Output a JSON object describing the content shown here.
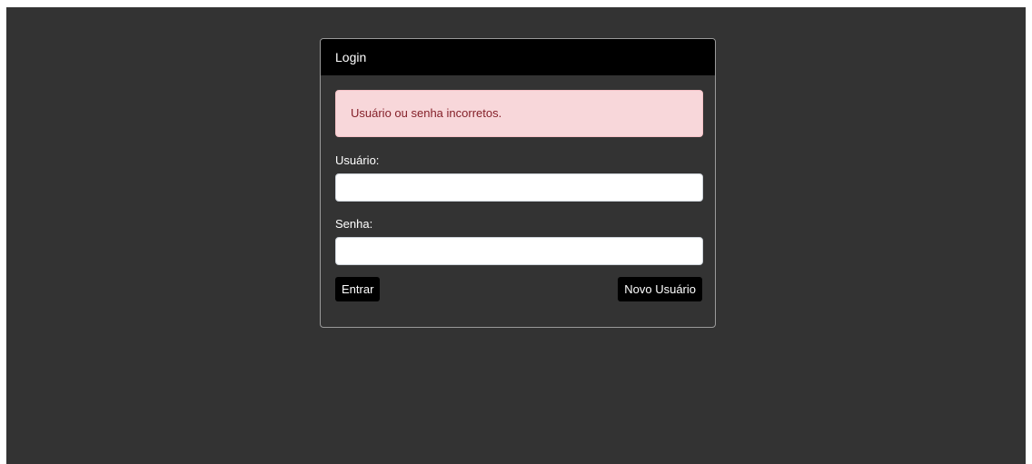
{
  "login": {
    "header_title": "Login",
    "alert_message": "Usuário ou senha incorretos.",
    "username_label": "Usuário:",
    "username_value": "",
    "password_label": "Senha:",
    "password_value": "",
    "submit_label": "Entrar",
    "new_user_label": "Novo Usuário"
  },
  "colors": {
    "page_background": "#333333",
    "header_background": "#000000",
    "alert_background": "#f8d7da",
    "alert_text": "#842029",
    "button_background": "#000000"
  }
}
